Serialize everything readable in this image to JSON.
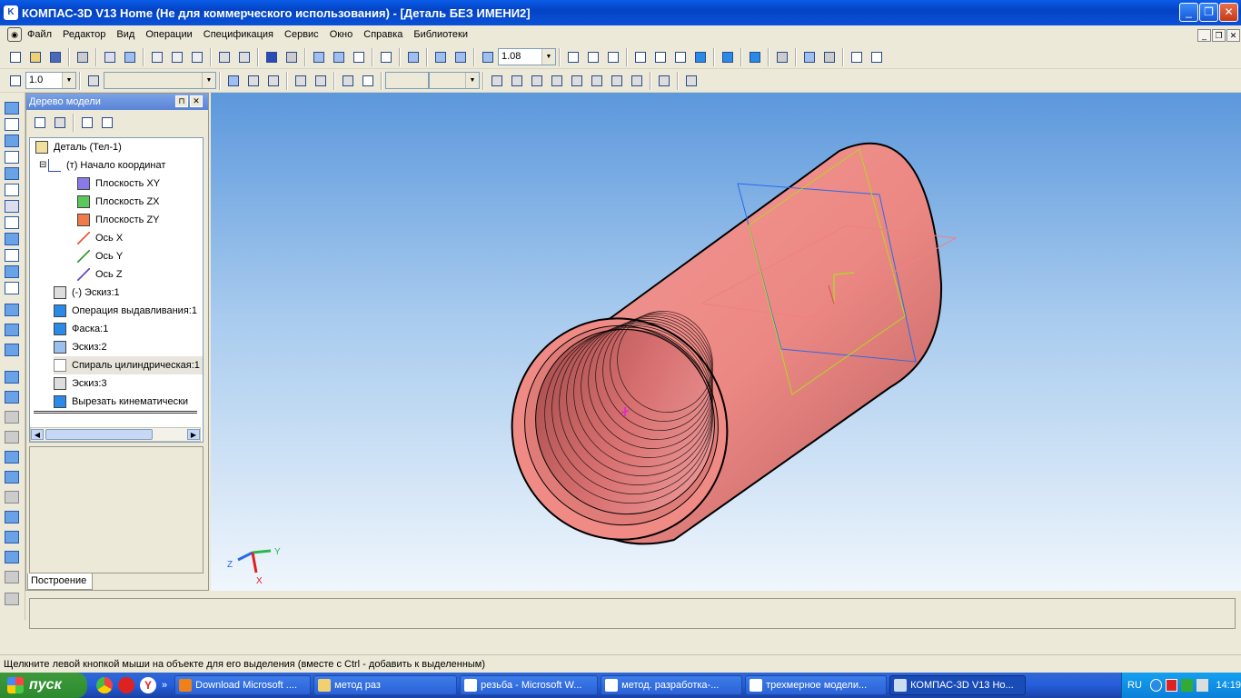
{
  "window": {
    "title": "КОМПАС-3D V13 Home (Не для коммерческого использования) - [Деталь БЕЗ ИМЕНИ2]",
    "controls": {
      "minimize": "_",
      "maximize": "❐",
      "close": "✕"
    }
  },
  "menu": [
    "Файл",
    "Редактор",
    "Вид",
    "Операции",
    "Спецификация",
    "Сервис",
    "Окно",
    "Справка",
    "Библиотеки"
  ],
  "mdi_controls": [
    "_",
    "❐",
    "✕"
  ],
  "toolbar": {
    "zoom_value": "1.08",
    "step_value": "1.0"
  },
  "tree": {
    "title": "Дерево модели",
    "pin": "⊓",
    "close": "✕",
    "items": [
      {
        "label": "Деталь (Тел-1)",
        "icon": "part-icon",
        "indent": 0
      },
      {
        "label": "(т) Начало координат",
        "icon": "origin-icon",
        "indent": 1,
        "expander": "⊟"
      },
      {
        "label": "Плоскость XY",
        "icon": "plane-xy-icon",
        "indent": 2
      },
      {
        "label": "Плоскость ZX",
        "icon": "plane-zx-icon",
        "indent": 2
      },
      {
        "label": "Плоскость ZY",
        "icon": "plane-zy-icon",
        "indent": 2
      },
      {
        "label": "Ось X",
        "icon": "axis-x-icon",
        "indent": 2
      },
      {
        "label": "Ось Y",
        "icon": "axis-y-icon",
        "indent": 2
      },
      {
        "label": "Ось Z",
        "icon": "axis-z-icon",
        "indent": 2
      },
      {
        "label": "(-) Эскиз:1",
        "icon": "sketch-icon",
        "indent": 1
      },
      {
        "label": "Операция выдавливания:1",
        "icon": "extrude-icon",
        "indent": 1
      },
      {
        "label": "Фаска:1",
        "icon": "chamfer-icon",
        "indent": 1
      },
      {
        "label": "Эскиз:2",
        "icon": "sketch-icon",
        "indent": 1
      },
      {
        "label": "Спираль цилиндрическая:1",
        "icon": "helix-icon",
        "indent": 1
      },
      {
        "label": "Эскиз:3",
        "icon": "sketch-icon",
        "indent": 1
      },
      {
        "label": "Вырезать кинематически",
        "icon": "sweep-cut-icon",
        "indent": 1
      }
    ],
    "bottom_tab": "Построение"
  },
  "axes": {
    "x": "X",
    "y": "Y",
    "z": "Z"
  },
  "status": "Щелкните левой кнопкой мыши на объекте для его выделения (вместе с Ctrl - добавить к выделенным)",
  "taskbar": {
    "start": "пуск",
    "items": [
      "Download Microsoft ....",
      "метод раз",
      "резьба - Microsoft W...",
      "метод. разработка-...",
      "трехмерное модели...",
      "КОМПАС-3D V13 Ho..."
    ],
    "lang": "RU",
    "time": "14:19"
  },
  "colors": {
    "part": "#f08a84",
    "part_dark": "#b05656",
    "viewport_top": "#5c98dc",
    "viewport_bottom": "#f0f6fc"
  }
}
